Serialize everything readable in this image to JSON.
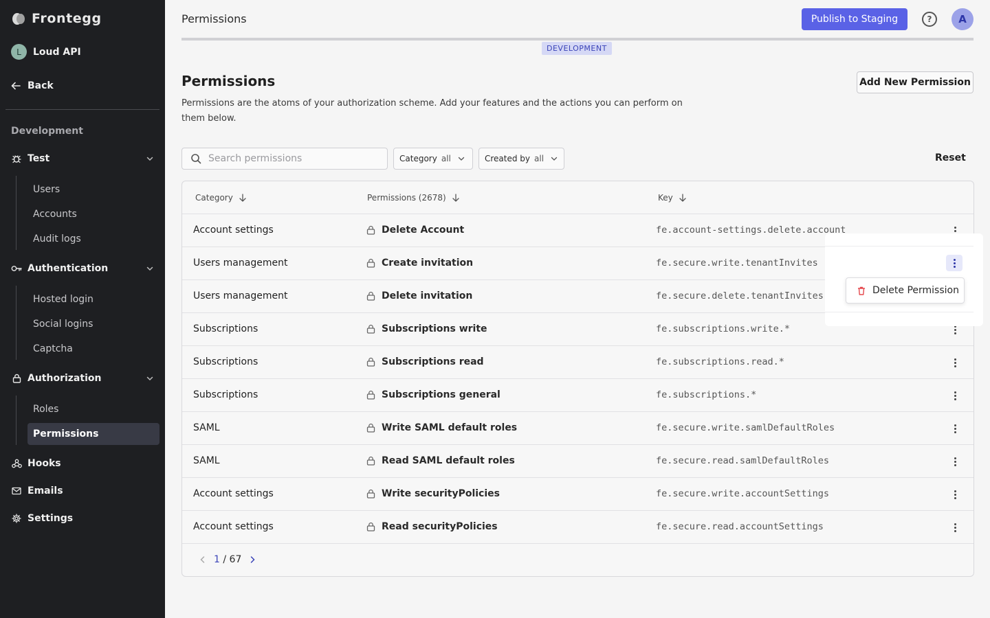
{
  "brand": {
    "name": "Frontegg"
  },
  "workspace": {
    "initial": "L",
    "name": "Loud API"
  },
  "sidebar": {
    "back_label": "Back",
    "env_label": "Development",
    "groups": [
      {
        "label": "Test",
        "items": [
          "Users",
          "Accounts",
          "Audit logs"
        ]
      },
      {
        "label": "Authentication",
        "items": [
          "Hosted login",
          "Social logins",
          "Captcha"
        ]
      },
      {
        "label": "Authorization",
        "items": [
          "Roles",
          "Permissions"
        ]
      }
    ],
    "bottom": [
      "Hooks",
      "Emails",
      "Settings"
    ],
    "active_item": "Permissions"
  },
  "topbar": {
    "title": "Permissions",
    "publish_label": "Publish to Staging",
    "help_label": "?",
    "user_initial": "A",
    "env_badge": "DEVELOPMENT"
  },
  "page": {
    "title": "Permissions",
    "description": "Permissions are the atoms of your authorization scheme.  Add your features and the actions you can perform on them below.",
    "add_label": "Add New Permission"
  },
  "filters": {
    "search_placeholder": "Search permissions",
    "category_label": "Category",
    "category_value": "all",
    "created_label": "Created by",
    "created_value": "all",
    "reset_label": "Reset"
  },
  "table": {
    "headers": {
      "category": "Category",
      "permissions": "Permissions  (2678)",
      "key": "Key"
    },
    "rows": [
      {
        "category": "Account settings",
        "permission": "Delete Account",
        "key": "fe.account-settings.delete.account"
      },
      {
        "category": "Users management",
        "permission": "Create invitation",
        "key": "fe.secure.write.tenantInvites"
      },
      {
        "category": "Users management",
        "permission": "Delete invitation",
        "key": "fe.secure.delete.tenantInvites"
      },
      {
        "category": "Subscriptions",
        "permission": "Subscriptions write",
        "key": "fe.subscriptions.write.*"
      },
      {
        "category": "Subscriptions",
        "permission": "Subscriptions read",
        "key": "fe.subscriptions.read.*"
      },
      {
        "category": "Subscriptions",
        "permission": "Subscriptions general",
        "key": "fe.subscriptions.*"
      },
      {
        "category": "SAML",
        "permission": "Write SAML default roles",
        "key": "fe.secure.write.samlDefaultRoles"
      },
      {
        "category": "SAML",
        "permission": "Read SAML default roles",
        "key": "fe.secure.read.samlDefaultRoles"
      },
      {
        "category": "Account settings",
        "permission": "Write securityPolicies",
        "key": "fe.secure.write.accountSettings"
      },
      {
        "category": "Account settings",
        "permission": "Read securityPolicies",
        "key": "fe.secure.read.accountSettings"
      }
    ]
  },
  "pagination": {
    "current": "1",
    "separator": "/",
    "total": "67"
  },
  "context_menu": {
    "delete_label": "Delete Permission"
  },
  "colors": {
    "accent": "#5a62e6",
    "sidebar_bg": "#1e1f22",
    "danger": "#e5484d",
    "active_item_bg": "#383a45"
  }
}
